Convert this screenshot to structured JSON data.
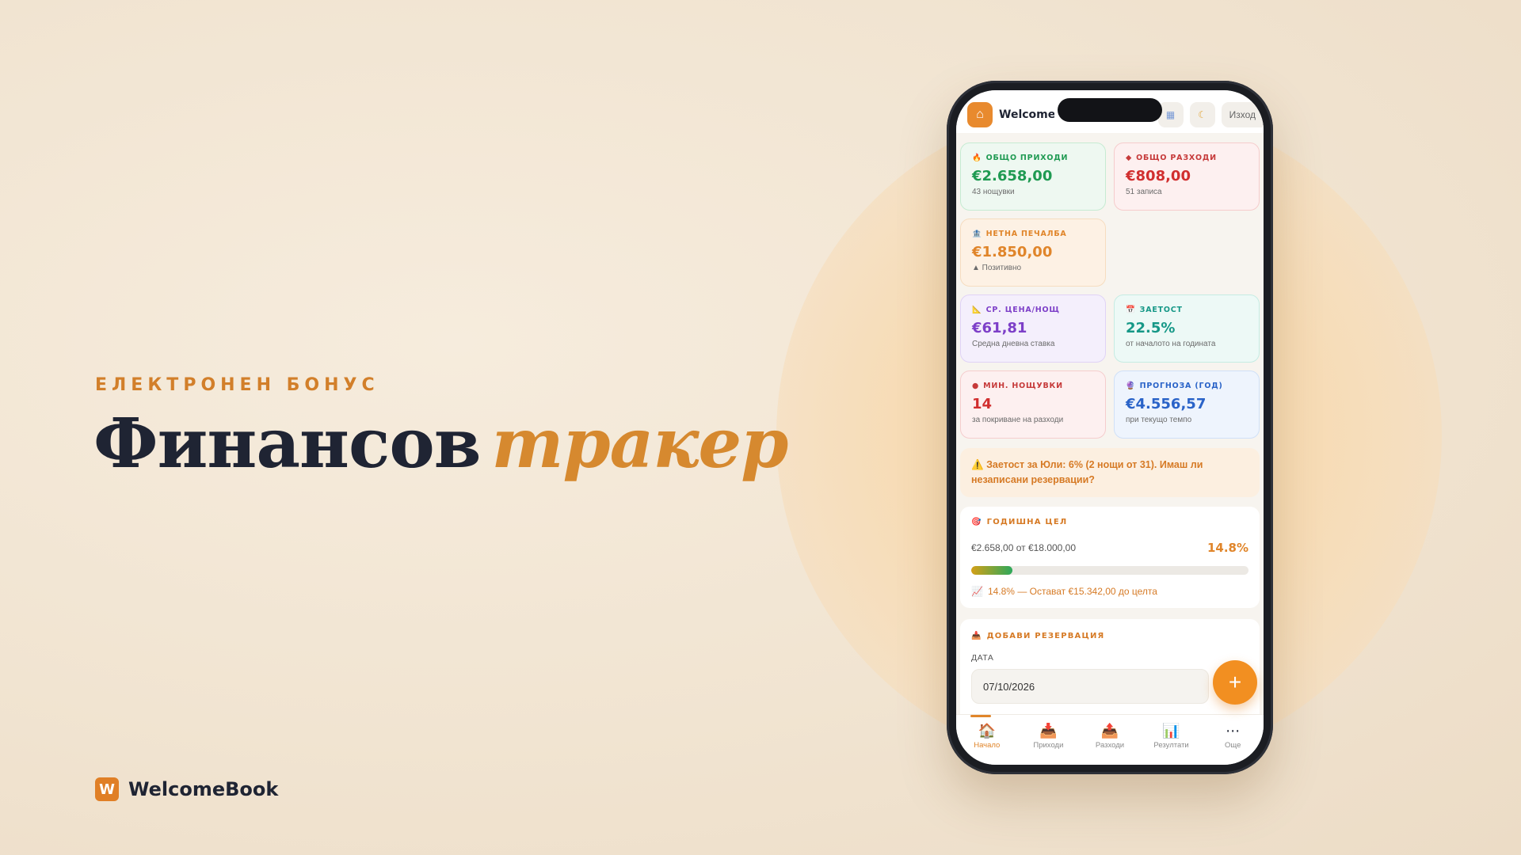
{
  "hero": {
    "eyebrow": "ЕЛЕКТРОНЕН БОНУС",
    "title_main": "Финансов",
    "title_accent": "тракер"
  },
  "brand": {
    "logo_letter": "W",
    "name": "WelcomeBook"
  },
  "app": {
    "title": "WelcomeB",
    "top_buttons": {
      "calendar_icon": "calendar-icon",
      "moon_icon": "moon-icon",
      "logout_label": "Изход"
    }
  },
  "stats": [
    {
      "key": "income",
      "icon": "🔥",
      "label": "ОБЩО ПРИХОДИ",
      "value": "€2.658,00",
      "sub": "43 нощувки",
      "color": "#1f9a52"
    },
    {
      "key": "expenses",
      "icon": "◆",
      "label": "ОБЩО РАЗХОДИ",
      "value": "€808,00",
      "sub": "51 записа",
      "color": "#d12f2f"
    },
    {
      "key": "net",
      "icon": "🏦",
      "label": "НЕТНА ПЕЧАЛБА",
      "value": "€1.850,00",
      "sub": "▲ Позитивно",
      "color": "#e0852a"
    },
    {
      "key": "avg",
      "icon": "📐",
      "label": "СР. ЦЕНА/НОЩ",
      "value": "€61,81",
      "sub": "Средна дневна ставка",
      "color": "#7d3fc8"
    },
    {
      "key": "occupancy",
      "icon": "📅",
      "label": "ЗАЕТОСТ",
      "value": "22.5%",
      "sub": "от началото на годината",
      "color": "#169887"
    },
    {
      "key": "min_nights",
      "icon": "●",
      "label": "МИН. НОЩУВКИ",
      "value": "14",
      "sub": "за покриване на разходи",
      "color": "#d12f2f"
    },
    {
      "key": "forecast",
      "icon": "🔮",
      "label": "ПРОГНОЗА (ГОД)",
      "value": "€4.556,57",
      "sub": "при текущо темпо",
      "color": "#2a63c8"
    }
  ],
  "alert": {
    "icon": "⚠️",
    "text": "Заетост за Юли: 6% (2 нощи от 31). Имаш ли незаписани резервации?"
  },
  "goal": {
    "icon": "🎯",
    "title": "ГОДИШНА ЦЕЛ",
    "amount": "€2.658,00 от €18.000,00",
    "percent_label": "14.8%",
    "progress": 0.148,
    "note_icon": "📈",
    "note": "14.8% — Остават €15.342,00 до целта"
  },
  "add_booking": {
    "icon": "📥",
    "title": "ДОБАВИ РЕЗЕРВАЦИЯ",
    "date_label": "ДАТА",
    "date_value": "07/10/2026",
    "fab_label": "+"
  },
  "nav": [
    {
      "icon": "🏠",
      "label": "Начало",
      "active": true
    },
    {
      "icon": "📥",
      "label": "Приходи",
      "active": false
    },
    {
      "icon": "📤",
      "label": "Разходи",
      "active": false
    },
    {
      "icon": "📊",
      "label": "Резултати",
      "active": false
    },
    {
      "icon": "⋯",
      "label": "Още",
      "active": false
    }
  ]
}
